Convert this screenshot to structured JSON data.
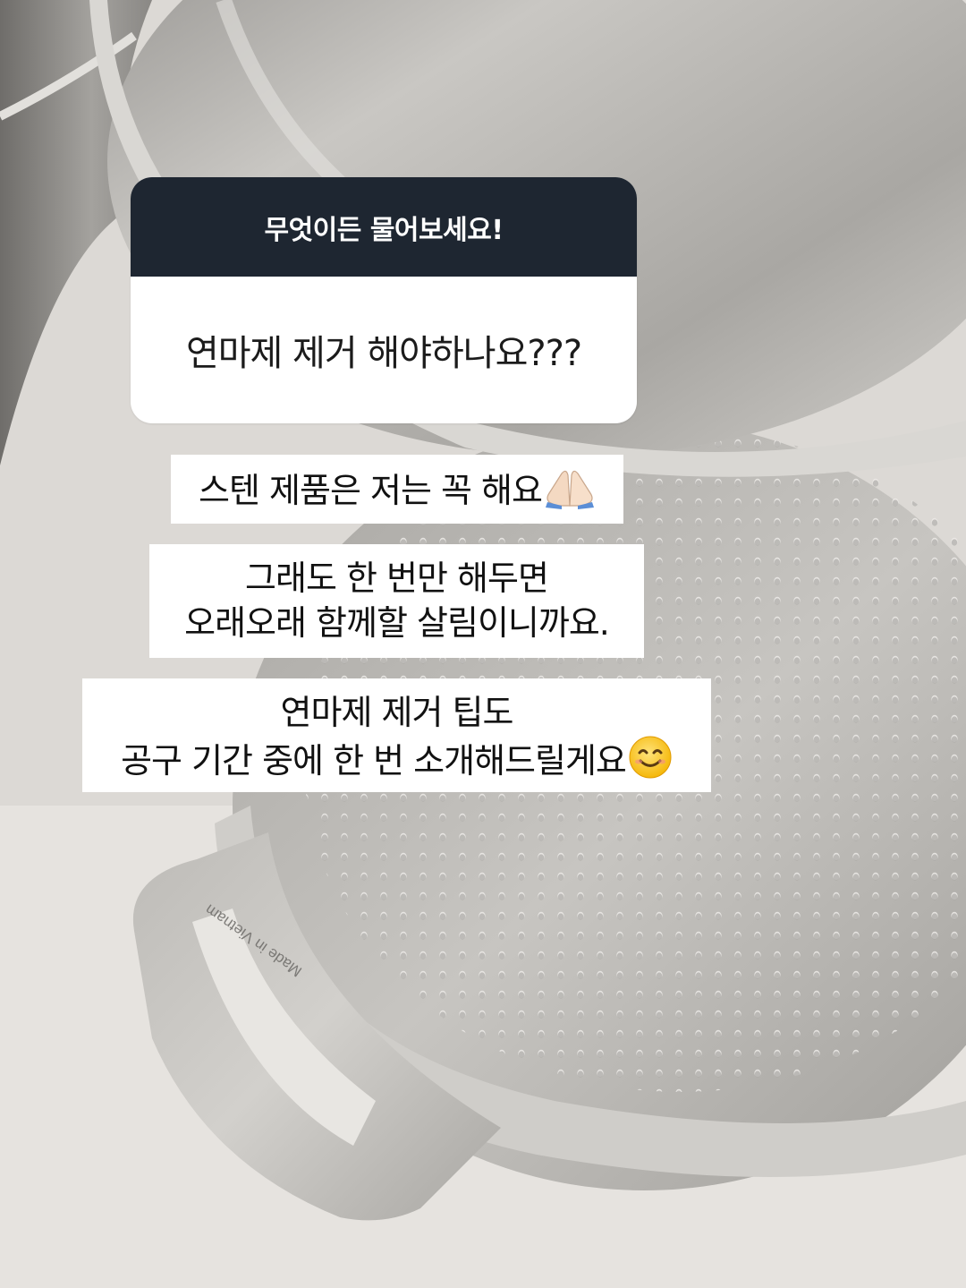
{
  "question_card": {
    "header": "무엇이든 물어보세요!",
    "question": "연마제 제거 해야하나요???"
  },
  "captions": [
    {
      "lines": [
        "스텐 제품은 저는 꼭 해요"
      ],
      "emoji": "folded-hands-icon"
    },
    {
      "lines": [
        "그래도 한 번만 해두면",
        "오래오래 함께할 살림이니까요."
      ]
    },
    {
      "lines": [
        "연마제 제거 팁도",
        "공구 기간 중에 한 번 소개해드릴게요"
      ],
      "emoji": "smiling-face-icon"
    }
  ],
  "imprint": "Made in Vietnam",
  "colors": {
    "header_bg": "#1e2631",
    "card_bg": "#ffffff",
    "steel": "#b9b7b3",
    "background": "#e9e6e2"
  }
}
